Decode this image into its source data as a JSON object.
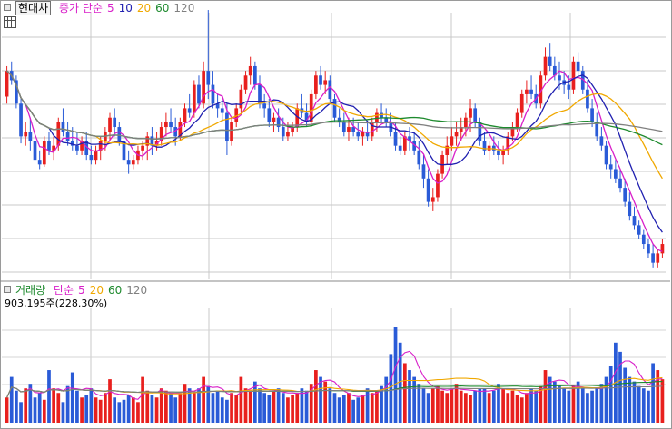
{
  "price_legend": {
    "name": "현대차",
    "ma_label": "종가 단순",
    "periods": [
      "5",
      "10",
      "20",
      "60",
      "120"
    ]
  },
  "volume_legend": {
    "name": "거래량",
    "ma_label": "단순",
    "periods": [
      "5",
      "20",
      "60",
      "120"
    ],
    "readout": "903,195주(228.30%)"
  },
  "colors": {
    "up": "#e8201e",
    "down": "#2a5bd7",
    "ma5": "#d81fc9",
    "ma10": "#2020b0",
    "ma20": "#f0a800",
    "ma60": "#1e8a2e",
    "ma120": "#808080"
  },
  "chart_data": [
    {
      "type": "candlestick",
      "grid": true,
      "ylim": [
        0,
        100
      ],
      "candles": [
        [
          75,
          88,
          72,
          86
        ],
        [
          86,
          90,
          80,
          82
        ],
        [
          82,
          84,
          70,
          72
        ],
        [
          72,
          74,
          55,
          58
        ],
        [
          58,
          64,
          54,
          60
        ],
        [
          60,
          66,
          52,
          56
        ],
        [
          56,
          62,
          45,
          48
        ],
        [
          48,
          52,
          44,
          46
        ],
        [
          46,
          58,
          45,
          56
        ],
        [
          56,
          60,
          50,
          52
        ],
        [
          52,
          58,
          48,
          54
        ],
        [
          54,
          66,
          52,
          64
        ],
        [
          64,
          70,
          58,
          60
        ],
        [
          60,
          64,
          54,
          56
        ],
        [
          56,
          62,
          52,
          54
        ],
        [
          54,
          60,
          50,
          52
        ],
        [
          52,
          58,
          50,
          56
        ],
        [
          56,
          60,
          48,
          50
        ],
        [
          50,
          54,
          46,
          48
        ],
        [
          48,
          54,
          46,
          52
        ],
        [
          52,
          58,
          48,
          56
        ],
        [
          56,
          62,
          52,
          60
        ],
        [
          60,
          68,
          56,
          66
        ],
        [
          66,
          70,
          58,
          62
        ],
        [
          62,
          64,
          54,
          56
        ],
        [
          56,
          58,
          46,
          48
        ],
        [
          48,
          52,
          42,
          46
        ],
        [
          46,
          50,
          44,
          48
        ],
        [
          48,
          54,
          46,
          52
        ],
        [
          52,
          56,
          48,
          54
        ],
        [
          54,
          60,
          48,
          58
        ],
        [
          58,
          62,
          50,
          54
        ],
        [
          54,
          60,
          52,
          56
        ],
        [
          56,
          64,
          54,
          62
        ],
        [
          62,
          68,
          58,
          64
        ],
        [
          64,
          70,
          60,
          62
        ],
        [
          62,
          66,
          54,
          58
        ],
        [
          58,
          66,
          56,
          64
        ],
        [
          64,
          72,
          62,
          70
        ],
        [
          70,
          76,
          66,
          68
        ],
        [
          68,
          82,
          66,
          80
        ],
        [
          80,
          84,
          70,
          72
        ],
        [
          72,
          90,
          70,
          86
        ],
        [
          86,
          112,
          74,
          80
        ],
        [
          80,
          86,
          70,
          72
        ],
        [
          72,
          76,
          66,
          70
        ],
        [
          70,
          74,
          64,
          68
        ],
        [
          68,
          72,
          50,
          56
        ],
        [
          56,
          66,
          54,
          64
        ],
        [
          64,
          72,
          62,
          70
        ],
        [
          70,
          80,
          68,
          78
        ],
        [
          78,
          86,
          76,
          84
        ],
        [
          84,
          92,
          80,
          88
        ],
        [
          88,
          90,
          78,
          80
        ],
        [
          80,
          84,
          70,
          72
        ],
        [
          72,
          76,
          66,
          70
        ],
        [
          70,
          74,
          62,
          64
        ],
        [
          64,
          68,
          60,
          66
        ],
        [
          66,
          70,
          60,
          62
        ],
        [
          62,
          66,
          56,
          58
        ],
        [
          58,
          64,
          56,
          60
        ],
        [
          60,
          64,
          58,
          62
        ],
        [
          62,
          72,
          60,
          70
        ],
        [
          70,
          76,
          66,
          68
        ],
        [
          68,
          72,
          62,
          64
        ],
        [
          64,
          78,
          62,
          76
        ],
        [
          76,
          86,
          74,
          84
        ],
        [
          84,
          88,
          78,
          80
        ],
        [
          80,
          86,
          76,
          82
        ],
        [
          82,
          84,
          72,
          74
        ],
        [
          74,
          76,
          64,
          66
        ],
        [
          66,
          70,
          62,
          64
        ],
        [
          64,
          68,
          58,
          60
        ],
        [
          60,
          66,
          56,
          62
        ],
        [
          62,
          66,
          58,
          60
        ],
        [
          60,
          64,
          56,
          58
        ],
        [
          58,
          62,
          54,
          60
        ],
        [
          60,
          64,
          56,
          58
        ],
        [
          58,
          66,
          56,
          64
        ],
        [
          64,
          70,
          60,
          68
        ],
        [
          68,
          72,
          64,
          66
        ],
        [
          66,
          70,
          62,
          64
        ],
        [
          64,
          68,
          58,
          60
        ],
        [
          60,
          64,
          52,
          54
        ],
        [
          54,
          58,
          50,
          52
        ],
        [
          52,
          60,
          50,
          58
        ],
        [
          58,
          62,
          52,
          56
        ],
        [
          56,
          60,
          50,
          52
        ],
        [
          52,
          56,
          44,
          46
        ],
        [
          46,
          50,
          36,
          40
        ],
        [
          40,
          44,
          28,
          30
        ],
        [
          30,
          36,
          26,
          32
        ],
        [
          32,
          44,
          30,
          42
        ],
        [
          42,
          52,
          40,
          50
        ],
        [
          50,
          58,
          46,
          54
        ],
        [
          54,
          62,
          52,
          58
        ],
        [
          58,
          64,
          54,
          60
        ],
        [
          60,
          66,
          56,
          62
        ],
        [
          62,
          68,
          58,
          66
        ],
        [
          66,
          74,
          60,
          70
        ],
        [
          70,
          72,
          62,
          64
        ],
        [
          64,
          66,
          54,
          56
        ],
        [
          56,
          60,
          50,
          52
        ],
        [
          52,
          56,
          48,
          54
        ],
        [
          54,
          58,
          50,
          52
        ],
        [
          52,
          56,
          48,
          50
        ],
        [
          50,
          54,
          46,
          52
        ],
        [
          52,
          60,
          50,
          58
        ],
        [
          58,
          64,
          56,
          62
        ],
        [
          62,
          70,
          60,
          68
        ],
        [
          68,
          78,
          66,
          76
        ],
        [
          76,
          82,
          72,
          78
        ],
        [
          78,
          84,
          74,
          76
        ],
        [
          76,
          80,
          70,
          72
        ],
        [
          72,
          86,
          70,
          84
        ],
        [
          84,
          96,
          82,
          92
        ],
        [
          92,
          98,
          86,
          88
        ],
        [
          88,
          92,
          82,
          84
        ],
        [
          84,
          90,
          78,
          82
        ],
        [
          82,
          86,
          76,
          80
        ],
        [
          80,
          84,
          74,
          78
        ],
        [
          78,
          92,
          76,
          90
        ],
        [
          90,
          94,
          84,
          86
        ],
        [
          86,
          88,
          76,
          78
        ],
        [
          78,
          82,
          68,
          70
        ],
        [
          70,
          74,
          62,
          64
        ],
        [
          64,
          68,
          56,
          58
        ],
        [
          58,
          62,
          52,
          54
        ],
        [
          54,
          56,
          44,
          46
        ],
        [
          46,
          50,
          40,
          44
        ],
        [
          44,
          48,
          38,
          40
        ],
        [
          40,
          44,
          34,
          36
        ],
        [
          36,
          40,
          28,
          30
        ],
        [
          30,
          34,
          22,
          24
        ],
        [
          24,
          28,
          18,
          20
        ],
        [
          20,
          22,
          14,
          16
        ],
        [
          16,
          18,
          10,
          12
        ],
        [
          12,
          14,
          6,
          8
        ],
        [
          8,
          12,
          2,
          4
        ],
        [
          4,
          10,
          2,
          8
        ],
        [
          8,
          14,
          6,
          12
        ]
      ],
      "ma_periods": [
        5,
        10,
        20,
        60,
        120
      ]
    },
    {
      "type": "bar",
      "title": "거래량",
      "values": [
        22,
        40,
        28,
        18,
        30,
        34,
        22,
        26,
        20,
        46,
        30,
        26,
        18,
        32,
        44,
        28,
        22,
        24,
        30,
        22,
        20,
        26,
        38,
        22,
        18,
        20,
        24,
        22,
        18,
        40,
        28,
        24,
        22,
        30,
        28,
        26,
        22,
        26,
        34,
        30,
        26,
        30,
        40,
        32,
        26,
        28,
        22,
        20,
        26,
        24,
        40,
        30,
        28,
        36,
        30,
        26,
        24,
        28,
        30,
        26,
        22,
        24,
        26,
        30,
        28,
        34,
        46,
        40,
        36,
        30,
        26,
        22,
        24,
        26,
        20,
        22,
        24,
        30,
        26,
        28,
        32,
        40,
        60,
        84,
        70,
        52,
        46,
        40,
        34,
        30,
        26,
        30,
        32,
        28,
        26,
        30,
        34,
        28,
        26,
        24,
        28,
        30,
        30,
        26,
        28,
        34,
        30,
        26,
        28,
        24,
        22,
        26,
        30,
        28,
        32,
        46,
        40,
        36,
        32,
        30,
        28,
        32,
        36,
        30,
        26,
        28,
        30,
        34,
        40,
        50,
        70,
        62,
        48,
        40,
        36,
        32,
        30,
        28,
        52,
        46,
        38
      ],
      "ma_periods": [
        5,
        20,
        60,
        120
      ]
    }
  ]
}
